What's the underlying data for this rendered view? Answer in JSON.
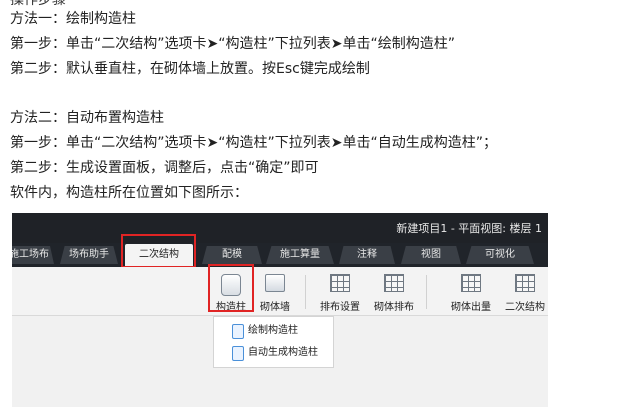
{
  "document": {
    "top_cut_text": "操作步骤",
    "lines": [
      "方法一：绘制构造柱",
      "第一步：单击“二次结构”选项卡➤“构造柱”下拉列表➤单击“绘制构造柱”",
      "第二步：默认垂直柱，在砌体墙上放置。按Esc键完成绘制",
      "",
      "方法二：自动布置构造柱",
      "第一步：单击“二次结构”选项卡➤“构造柱”下拉列表➤单击“自动生成构造柱”；",
      "第二步：生成设置面板，调整后，点击“确定”即可",
      "软件内，构造柱所在位置如下图所示："
    ]
  },
  "ui": {
    "window_title": "新建项目1 - 平面视图: 楼层 1",
    "tabs": [
      "施工场布",
      "场布助手",
      "二次结构",
      "配模",
      "施工算量",
      "注释",
      "视图",
      "可视化"
    ],
    "active_tab": "二次结构",
    "tools": [
      "构造柱",
      "砌体墙",
      "排布设置",
      "砌体排布",
      "砌体出量",
      "二次结构"
    ],
    "menu_items": [
      "绘制构造柱",
      "自动生成构造柱"
    ],
    "colors": {
      "highlight": "#e02424",
      "titlebar": "#1f2227",
      "ribbon": "#f3f3f3"
    },
    "icons": {
      "column": "column-icon",
      "wall": "wall-icon",
      "layout_settings": "grid-icon",
      "masonry_layout": "grid-icon",
      "masonry_output": "grid-icon",
      "secondary_structure": "grid-icon",
      "draw_column": "pencil-icon",
      "auto_column": "search-icon"
    }
  }
}
